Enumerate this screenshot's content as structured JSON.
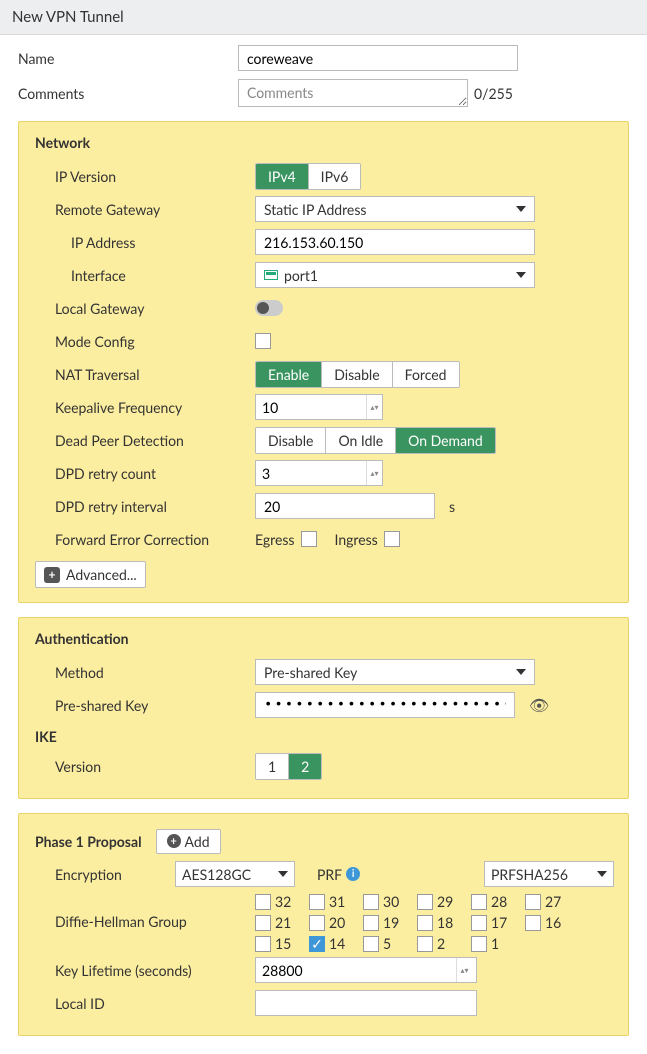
{
  "title": "New VPN Tunnel",
  "top": {
    "name_label": "Name",
    "name_value": "coreweave",
    "comments_label": "Comments",
    "comments_placeholder": "Comments",
    "comments_counter": "0/255"
  },
  "network": {
    "head": "Network",
    "ip_version_label": "IP Version",
    "ipv4": "IPv4",
    "ipv6": "IPv6",
    "remote_gw_label": "Remote Gateway",
    "remote_gw_value": "Static IP Address",
    "ip_addr_label": "IP Address",
    "ip_addr_value": "216.153.60.150",
    "interface_label": "Interface",
    "interface_value": "port1",
    "local_gw_label": "Local Gateway",
    "mode_config_label": "Mode Config",
    "nat_label": "NAT Traversal",
    "nat_enable": "Enable",
    "nat_disable": "Disable",
    "nat_forced": "Forced",
    "keepalive_label": "Keepalive Frequency",
    "keepalive_value": "10",
    "dpd_label": "Dead Peer Detection",
    "dpd_disable": "Disable",
    "dpd_idle": "On Idle",
    "dpd_demand": "On Demand",
    "dpd_retry_count_label": "DPD retry count",
    "dpd_retry_count_value": "3",
    "dpd_retry_int_label": "DPD retry interval",
    "dpd_retry_int_value": "20",
    "dpd_retry_int_unit": "s",
    "fec_label": "Forward Error Correction",
    "fec_egress": "Egress",
    "fec_ingress": "Ingress",
    "advanced": "Advanced..."
  },
  "auth": {
    "head": "Authentication",
    "method_label": "Method",
    "method_value": "Pre-shared Key",
    "psk_label": "Pre-shared Key",
    "psk_mask": "••••••••••••••••••••••••",
    "ike_head": "IKE",
    "version_label": "Version",
    "v1": "1",
    "v2": "2"
  },
  "phase1": {
    "head": "Phase 1 Proposal",
    "add": "Add",
    "enc_label": "Encryption",
    "enc_value": "AES128GC",
    "prf_label": "PRF",
    "prf_value": "PRFSHA256",
    "dh_label": "Diffie-Hellman Group",
    "dh": [
      "32",
      "31",
      "30",
      "29",
      "28",
      "27",
      "21",
      "20",
      "19",
      "18",
      "17",
      "16",
      "15",
      "14",
      "5",
      "2",
      "1"
    ],
    "dh_checked": "14",
    "keylife_label": "Key Lifetime (seconds)",
    "keylife_value": "28800",
    "localid_label": "Local ID"
  }
}
